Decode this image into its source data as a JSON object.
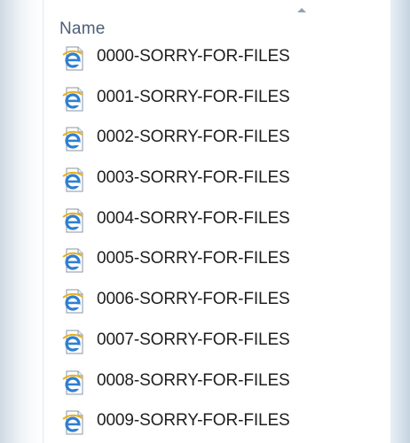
{
  "header": {
    "name_column": "Name",
    "sort_direction": "ascending"
  },
  "files": [
    {
      "name": "0000-SORRY-FOR-FILES",
      "icon": "internet-explorer-html-file-icon"
    },
    {
      "name": "0001-SORRY-FOR-FILES",
      "icon": "internet-explorer-html-file-icon"
    },
    {
      "name": "0002-SORRY-FOR-FILES",
      "icon": "internet-explorer-html-file-icon"
    },
    {
      "name": "0003-SORRY-FOR-FILES",
      "icon": "internet-explorer-html-file-icon"
    },
    {
      "name": "0004-SORRY-FOR-FILES",
      "icon": "internet-explorer-html-file-icon"
    },
    {
      "name": "0005-SORRY-FOR-FILES",
      "icon": "internet-explorer-html-file-icon"
    },
    {
      "name": "0006-SORRY-FOR-FILES",
      "icon": "internet-explorer-html-file-icon"
    },
    {
      "name": "0007-SORRY-FOR-FILES",
      "icon": "internet-explorer-html-file-icon"
    },
    {
      "name": "0008-SORRY-FOR-FILES",
      "icon": "internet-explorer-html-file-icon"
    },
    {
      "name": "0009-SORRY-FOR-FILES",
      "icon": "internet-explorer-html-file-icon"
    }
  ],
  "colors": {
    "header_text": "#4c607a",
    "file_text": "#1e1e1e",
    "ie_blue": "#2f7fd1",
    "ie_gold": "#e8b21c"
  }
}
